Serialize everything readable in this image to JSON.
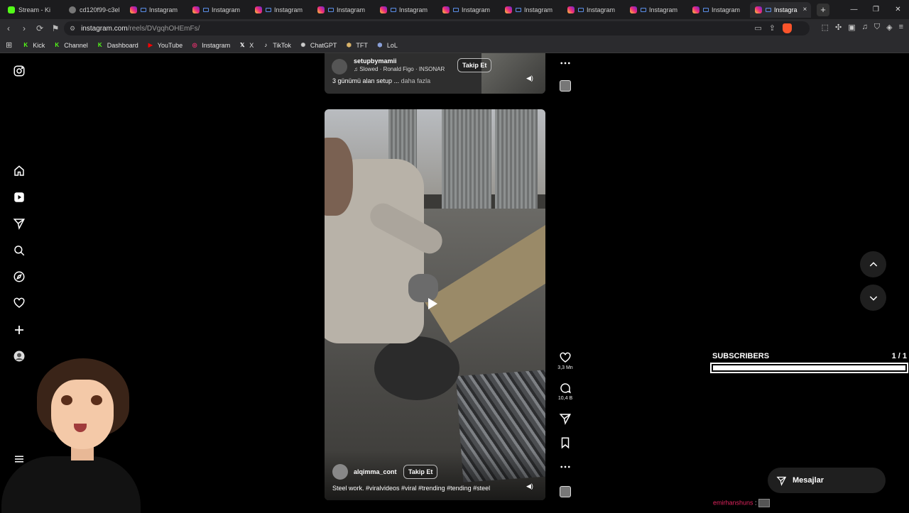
{
  "browser": {
    "tabs": [
      {
        "label": "Stream - Ki",
        "icon": "kick"
      },
      {
        "label": "cd120f99-c3el",
        "icon": "generic"
      },
      {
        "label": "Instagram",
        "icon": "instagram"
      },
      {
        "label": "Instagram",
        "icon": "instagram"
      },
      {
        "label": "Instagram",
        "icon": "instagram"
      },
      {
        "label": "Instagram",
        "icon": "instagram"
      },
      {
        "label": "Instagram",
        "icon": "instagram"
      },
      {
        "label": "Instagram",
        "icon": "instagram"
      },
      {
        "label": "Instagram",
        "icon": "instagram"
      },
      {
        "label": "Instagram",
        "icon": "instagram"
      },
      {
        "label": "Instagram",
        "icon": "instagram"
      },
      {
        "label": "Instagram",
        "icon": "instagram"
      },
      {
        "label": "Instagra",
        "icon": "instagram",
        "active": true
      }
    ],
    "close_tab": "×",
    "new_tab": "+",
    "window_controls": [
      "—",
      "❐",
      "✕"
    ],
    "url_host": "instagram.com",
    "url_path": "/reels/DVgqhOHEmFs/",
    "bookmarks": [
      {
        "label": "Kick",
        "icon": "K",
        "color": "#53fc18"
      },
      {
        "label": "Channel",
        "icon": "K",
        "color": "#53fc18"
      },
      {
        "label": "Dashboard",
        "icon": "K",
        "color": "#53fc18"
      },
      {
        "label": "YouTube",
        "icon": "▶",
        "color": "#ff0000"
      },
      {
        "label": "Instagram",
        "icon": "◎",
        "color": "#e1306c"
      },
      {
        "label": "X",
        "icon": "𝕏",
        "color": "#ffffff"
      },
      {
        "label": "TikTok",
        "icon": "♪",
        "color": "#ffffff"
      },
      {
        "label": "ChatGPT",
        "icon": "✺",
        "color": "#cccccc"
      },
      {
        "label": "TFT",
        "icon": "⬢",
        "color": "#d9b36a"
      },
      {
        "label": "LoL",
        "icon": "⬢",
        "color": "#8aa0d8"
      }
    ]
  },
  "reel_top": {
    "username": "setupbymamii",
    "music": "Slowed · Ronald Figo · INSONAR",
    "follow_label": "Takip Et",
    "caption": "3 günümü alan setup ...",
    "more": "daha fazla"
  },
  "reel_main": {
    "username": "alqimma_cont",
    "follow_label": "Takip Et",
    "caption": "Steel work. #viralvideos #viral #trending #tending #steel"
  },
  "actions": {
    "like_count": "3,3 Mn",
    "comment_count": "10,4 B"
  },
  "subscribers": {
    "label": "SUBSCRIBERS",
    "count": "1 / 1",
    "progress": 1.0
  },
  "messages_label": "Mesajlar",
  "chat": {
    "name": "emirhanshuns",
    "sep": ":"
  },
  "colors": {
    "background": "#000000",
    "accent_red": "#e0245e"
  }
}
